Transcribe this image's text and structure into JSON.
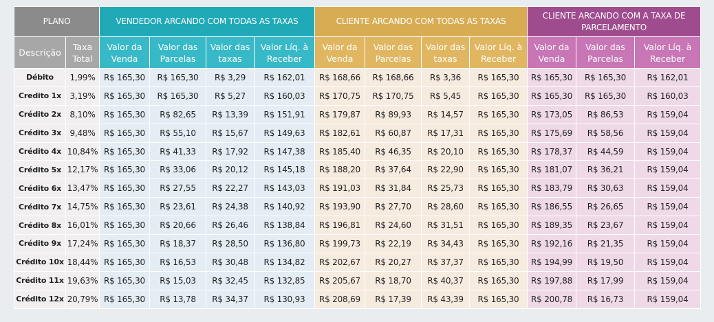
{
  "header": {
    "plano": "PLANO",
    "group_vendedor": "VENDEDOR ARCANDO COM TODAS AS TAXAS",
    "group_cliente": "CLIENTE ARCANDO COM TODAS AS TAXAS",
    "group_parcelamento": "CLIENTE ARCANDO COM A TAXA DE PARCELAMENTO",
    "col_descricao": "Descrição",
    "col_taxa_total": "Taxa Total",
    "vendedor_cols": [
      "Valor da Venda",
      "Valor das Parcelas",
      "Valor das taxas",
      "Valor Líq. à Receber"
    ],
    "cliente_cols": [
      "Valor da Venda",
      "Valor das Parcelas",
      "Valor das taxas",
      "Valor Líq. à Receber"
    ],
    "parcelamento_cols": [
      "Valor da Venda",
      "Valor das Parcelas",
      "Valor Líq. à Receber"
    ]
  },
  "rows": [
    {
      "label": "Débito",
      "taxa": "1,99%",
      "vendedor": [
        "R$ 165,30",
        "R$ 165,30",
        "R$ 3,29",
        "R$ 162,01"
      ],
      "cliente": [
        "R$ 168,66",
        "R$ 168,66",
        "R$ 3,36",
        "R$ 165,30"
      ],
      "parcelamento": [
        "R$ 165,30",
        "R$ 165,30",
        "R$ 162,01"
      ]
    },
    {
      "label": "Credito 1x",
      "taxa": "3,19%",
      "vendedor": [
        "R$ 165,30",
        "R$ 165,30",
        "R$ 5,27",
        "R$ 160,03"
      ],
      "cliente": [
        "R$ 170,75",
        "R$ 170,75",
        "R$ 5,45",
        "R$ 165,30"
      ],
      "parcelamento": [
        "R$ 165,30",
        "R$ 165,30",
        "R$ 160,03"
      ]
    },
    {
      "label": "Crédito 2x",
      "taxa": "8,10%",
      "vendedor": [
        "R$ 165,30",
        "R$ 82,65",
        "R$ 13,39",
        "R$ 151,91"
      ],
      "cliente": [
        "R$ 179,87",
        "R$ 89,93",
        "R$ 14,57",
        "R$ 165,30"
      ],
      "parcelamento": [
        "R$ 173,05",
        "R$ 86,53",
        "R$ 159,04"
      ]
    },
    {
      "label": "Crédito 3x",
      "taxa": "9,48%",
      "vendedor": [
        "R$ 165,30",
        "R$ 55,10",
        "R$ 15,67",
        "R$ 149,63"
      ],
      "cliente": [
        "R$ 182,61",
        "R$ 60,87",
        "R$ 17,31",
        "R$ 165,30"
      ],
      "parcelamento": [
        "R$ 175,69",
        "R$ 58,56",
        "R$ 159,04"
      ]
    },
    {
      "label": "Crédito 4x",
      "taxa": "10,84%",
      "vendedor": [
        "R$ 165,30",
        "R$ 41,33",
        "R$ 17,92",
        "R$ 147,38"
      ],
      "cliente": [
        "R$ 185,40",
        "R$ 46,35",
        "R$ 20,10",
        "R$ 165,30"
      ],
      "parcelamento": [
        "R$ 178,37",
        "R$ 44,59",
        "R$ 159,04"
      ]
    },
    {
      "label": "Crédito 5x",
      "taxa": "12,17%",
      "vendedor": [
        "R$ 165,30",
        "R$ 33,06",
        "R$ 20,12",
        "R$ 145,18"
      ],
      "cliente": [
        "R$ 188,20",
        "R$ 37,64",
        "R$ 22,90",
        "R$ 165,30"
      ],
      "parcelamento": [
        "R$ 181,07",
        "R$ 36,21",
        "R$ 159,04"
      ]
    },
    {
      "label": "Crédito 6x",
      "taxa": "13,47%",
      "vendedor": [
        "R$ 165,30",
        "R$ 27,55",
        "R$ 22,27",
        "R$ 143,03"
      ],
      "cliente": [
        "R$ 191,03",
        "R$ 31,84",
        "R$ 25,73",
        "R$ 165,30"
      ],
      "parcelamento": [
        "R$ 183,79",
        "R$ 30,63",
        "R$ 159,04"
      ]
    },
    {
      "label": "Crédito 7x",
      "taxa": "14,75%",
      "vendedor": [
        "R$ 165,30",
        "R$ 23,61",
        "R$ 24,38",
        "R$ 140,92"
      ],
      "cliente": [
        "R$ 193,90",
        "R$ 27,70",
        "R$ 28,60",
        "R$ 165,30"
      ],
      "parcelamento": [
        "R$ 186,55",
        "R$ 26,65",
        "R$ 159,04"
      ]
    },
    {
      "label": "Crédito 8x",
      "taxa": "16,01%",
      "vendedor": [
        "R$ 165,30",
        "R$ 20,66",
        "R$ 26,46",
        "R$ 138,84"
      ],
      "cliente": [
        "R$ 196,81",
        "R$ 24,60",
        "R$ 31,51",
        "R$ 165,30"
      ],
      "parcelamento": [
        "R$ 189,35",
        "R$ 23,67",
        "R$ 159,04"
      ]
    },
    {
      "label": "Crédito 9x",
      "taxa": "17,24%",
      "vendedor": [
        "R$ 165,30",
        "R$ 18,37",
        "R$ 28,50",
        "R$ 136,80"
      ],
      "cliente": [
        "R$ 199,73",
        "R$ 22,19",
        "R$ 34,43",
        "R$ 165,30"
      ],
      "parcelamento": [
        "R$ 192,16",
        "R$ 21,35",
        "R$ 159,04"
      ]
    },
    {
      "label": "Crédito 10x",
      "taxa": "18,44%",
      "vendedor": [
        "R$ 165,30",
        "R$ 16,53",
        "R$ 30,48",
        "R$ 134,82"
      ],
      "cliente": [
        "R$ 202,67",
        "R$ 20,27",
        "R$ 37,37",
        "R$ 165,30"
      ],
      "parcelamento": [
        "R$ 194,99",
        "R$ 19,50",
        "R$ 159,04"
      ]
    },
    {
      "label": "Crédito 11x",
      "taxa": "19,63%",
      "vendedor": [
        "R$ 165,30",
        "R$ 15,03",
        "R$ 32,45",
        "R$ 132,85"
      ],
      "cliente": [
        "R$ 205,67",
        "R$ 18,70",
        "R$ 40,37",
        "R$ 165,30"
      ],
      "parcelamento": [
        "R$ 197,88",
        "R$ 17,99",
        "R$ 159,04"
      ]
    },
    {
      "label": "Crédito 12x",
      "taxa": "20,79%",
      "vendedor": [
        "R$ 165,30",
        "R$ 13,78",
        "R$ 34,37",
        "R$ 130,93"
      ],
      "cliente": [
        "R$ 208,69",
        "R$ 17,39",
        "R$ 43,39",
        "R$ 165,30"
      ],
      "parcelamento": [
        "R$ 200,78",
        "R$ 16,73",
        "R$ 159,04"
      ]
    }
  ],
  "colors": {
    "plano": "#8b8b8b",
    "vendedor": "#20a9b7",
    "cliente": "#d8ac53",
    "parcelamento": "#9f4c8f"
  }
}
